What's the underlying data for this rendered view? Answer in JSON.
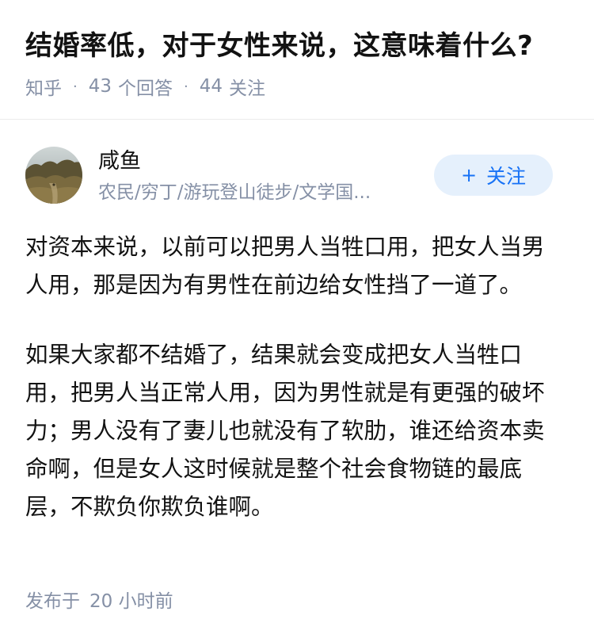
{
  "question": {
    "title": "结婚率低，对于女性来说，这意味着什么?",
    "source": "知乎",
    "answer_count": "43",
    "answer_label": "个回答",
    "follower_count": "44",
    "follower_label": "关注"
  },
  "author": {
    "name": "咸鱼",
    "bio": "农民/穷丁/游玩登山徒步/文学国...",
    "follow_label": "关注",
    "follow_icon": "plus-icon"
  },
  "answer": {
    "paragraphs": [
      "对资本来说，以前可以把男人当牲口用，把女人当男人用，那是因为有男性在前边给女性挡了一道了。",
      "如果大家都不结婚了，结果就会变成把女人当牲口用，把男人当正常人用，因为男性就是有更强的破坏力；男人没有了妻儿也就没有了软肋，谁还给资本卖命啊，但是女人这时候就是整个社会食物链的最底层，不欺负你欺负谁啊。"
    ],
    "published_label": "发布于",
    "published_time": "20 小时前"
  },
  "colors": {
    "title": "#121212",
    "meta": "#8590a6",
    "follow_bg": "#e5f0fc",
    "follow_text": "#1772f6",
    "divider": "#ebebeb"
  }
}
